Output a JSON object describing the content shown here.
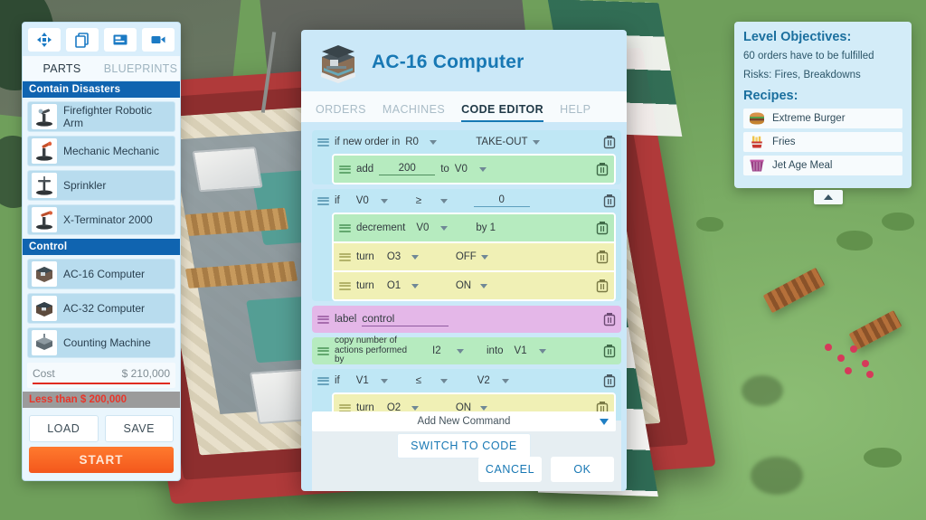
{
  "left_panel": {
    "tools": [
      {
        "name": "move-tool",
        "icon": "move-arrows-icon"
      },
      {
        "name": "copy-tool",
        "icon": "copy-icon"
      },
      {
        "name": "panel-tool",
        "icon": "window-icon"
      },
      {
        "name": "camera-tool",
        "icon": "video-camera-icon"
      }
    ],
    "tabs": [
      {
        "label": "PARTS",
        "active": true
      },
      {
        "label": "BLUEPRINTS",
        "active": false
      }
    ],
    "categories": [
      {
        "title": "Contain Disasters",
        "parts": [
          {
            "label": "Firefighter Robotic Arm",
            "icon": "robotic-arm-icon"
          },
          {
            "label": "Mechanic Mechanic",
            "icon": "robotic-arm-icon"
          },
          {
            "label": "Sprinkler",
            "icon": "sprinkler-icon"
          },
          {
            "label": "X-Terminator 2000",
            "icon": "robotic-arm-icon"
          }
        ]
      },
      {
        "title": "Control",
        "parts": [
          {
            "label": "AC-16 Computer",
            "icon": "computer-icon"
          },
          {
            "label": "AC-32 Computer",
            "icon": "computer-icon"
          },
          {
            "label": "Counting Machine",
            "icon": "counting-machine-icon"
          }
        ]
      }
    ],
    "cost_label": "Cost",
    "cost_value": "$ 210,000",
    "warning": "Less than $ 200,000",
    "load_label": "LOAD",
    "save_label": "SAVE",
    "start_label": "START",
    "colors": {
      "category_header": "#1064b0",
      "warning_text": "#e8352a",
      "start_button": "#f3571c"
    }
  },
  "dialog": {
    "title": "AC-16 Computer",
    "icon": "computer-icon",
    "tabs": [
      {
        "label": "ORDERS",
        "active": false
      },
      {
        "label": "MACHINES",
        "active": false
      },
      {
        "label": "CODE EDITOR",
        "active": true
      },
      {
        "label": "HELP",
        "active": false
      }
    ],
    "add_command_label": "Add New Command",
    "switch_label": "SWITCH TO CODE",
    "cancel_label": "CANCEL",
    "ok_label": "OK",
    "code": {
      "block1": {
        "keyword": "if new order in",
        "reg": "R0",
        "order_type": "TAKE-OUT",
        "child": {
          "keyword": "add",
          "value": "200",
          "to_label": "to",
          "target": "V0"
        }
      },
      "block2": {
        "keyword": "if",
        "var": "V0",
        "op": "≥",
        "value": "0",
        "children": [
          {
            "keyword": "decrement",
            "var": "V0",
            "suffix": "by 1"
          },
          {
            "keyword": "turn",
            "out": "O3",
            "state": "OFF"
          },
          {
            "keyword": "turn",
            "out": "O1",
            "state": "ON"
          }
        ]
      },
      "block3": {
        "keyword": "label",
        "value": "control"
      },
      "block4": {
        "keyword": "copy number of actions performed by",
        "source": "I2",
        "into_label": "into",
        "target": "V1"
      },
      "block5": {
        "keyword": "if",
        "var": "V1",
        "op": "≤",
        "var2": "V2",
        "children": [
          {
            "keyword": "turn",
            "out": "O2",
            "state": "ON"
          }
        ]
      }
    }
  },
  "right_panel": {
    "objectives_title": "Level Objectives:",
    "objectives": [
      "60 orders have to be fulfilled",
      "Risks: Fires, Breakdowns"
    ],
    "recipes_title": "Recipes:",
    "recipes": [
      {
        "label": "Extreme Burger",
        "icon": "burger-icon"
      },
      {
        "label": "Fries",
        "icon": "fries-icon"
      },
      {
        "label": "Jet Age Meal",
        "icon": "meal-box-icon"
      }
    ]
  }
}
